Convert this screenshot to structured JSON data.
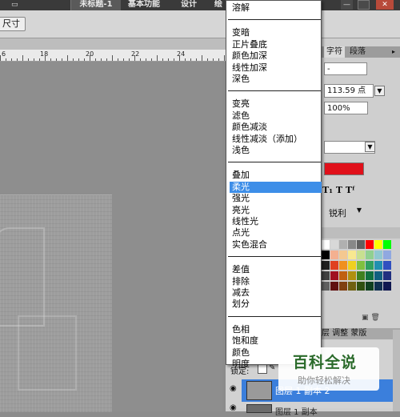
{
  "topbar": {
    "tool_glyph": "▭",
    "workspace_active": "未标题-1",
    "workspace_basic": "基本功能",
    "workspace_design": "设计",
    "workspace_more": "绘",
    "minimize": "—",
    "close": "✕"
  },
  "optbar": {
    "size_button": "尺寸"
  },
  "ruler": {
    "marks": [
      "6",
      "18",
      "20",
      "22",
      "24"
    ]
  },
  "char_panel": {
    "tab_char": "字符",
    "tab_para": "段落",
    "font_style": "-",
    "font_size": "113.59 点",
    "tracking": "100%",
    "color": "#e0101a",
    "type_icons": "T₁  T  Tᶠ",
    "anti_alias": "锐利"
  },
  "blend_menu": {
    "groups": [
      [
        "溶解"
      ],
      [
        "变暗",
        "正片叠底",
        "颜色加深",
        "线性加深",
        "深色"
      ],
      [
        "变亮",
        "滤色",
        "颜色减淡",
        "线性减淡（添加）",
        "浅色"
      ],
      [
        "叠加",
        "柔光",
        "强光",
        "亮光",
        "线性光",
        "点光",
        "实色混合"
      ],
      [
        "差值",
        "排除",
        "减去",
        "划分"
      ],
      [
        "色相",
        "饱和度",
        "颜色",
        "明度"
      ]
    ],
    "selected": "柔光"
  },
  "adjust_tabs": "层  调整  蒙版",
  "layers": {
    "lock_label": "锁定:",
    "layer1_name": "图层 1 副本 2",
    "layer2_name": "图层 1 副本"
  },
  "watermark": {
    "title": "百科全说",
    "subtitle": "助你轻松解决"
  },
  "colors": {
    "accent": "#3d8ee8",
    "swatch_red": "#e0101a"
  }
}
